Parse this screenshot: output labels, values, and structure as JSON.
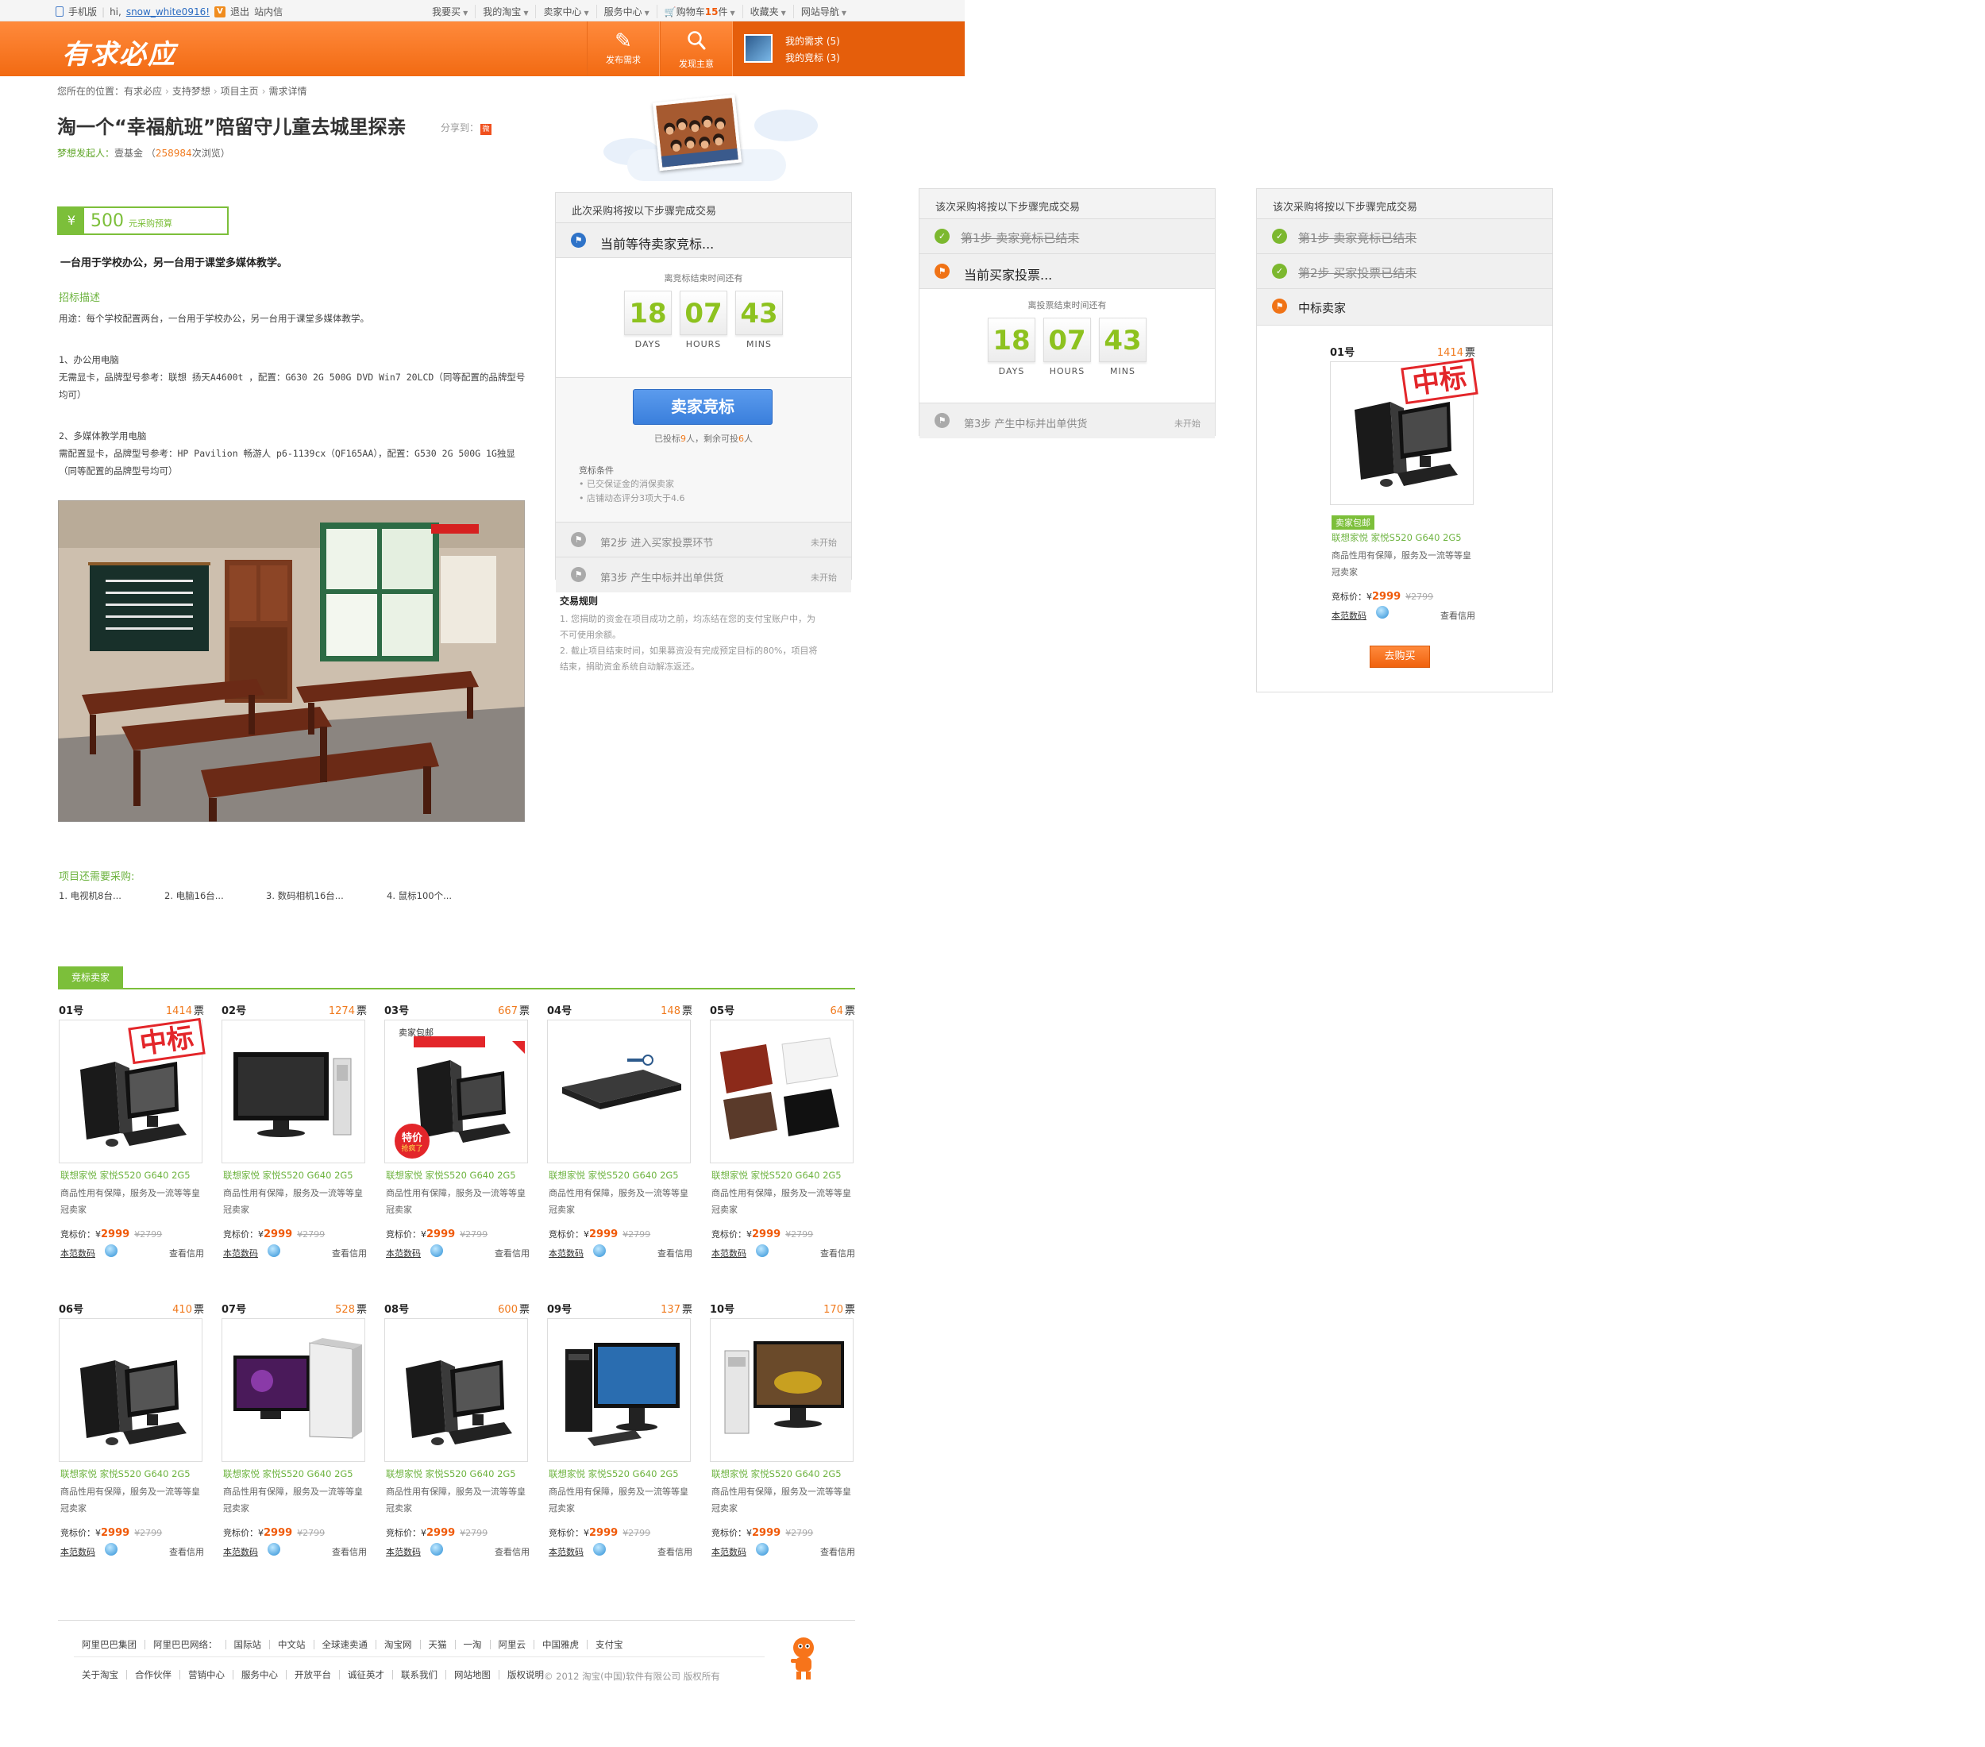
{
  "topbar": {
    "mobile": "手机版",
    "hi": "hi,",
    "username": "snow_white0916!",
    "v_badge": "V",
    "logout": "退出",
    "messages": "站内信",
    "links": [
      {
        "label": "我要买",
        "caret": true
      },
      {
        "label": "我的淘宝",
        "caret": true
      },
      {
        "label": "卖家中心",
        "caret": true
      },
      {
        "label": "服务中心",
        "caret": true
      },
      {
        "label": "购物车",
        "count": "15",
        "unit": "件",
        "caret": true
      },
      {
        "label": "收藏夹",
        "caret": true
      },
      {
        "label": "网站导航",
        "caret": true
      }
    ]
  },
  "header": {
    "logo": "有求必应",
    "btn_post": "发布需求",
    "btn_find": "发现主意",
    "my_requests": "我的需求 (5)",
    "my_bids": "我的竞标 (3)"
  },
  "breadcrumb": {
    "prefix": "您所在的位置：",
    "items": [
      "有求必应",
      "支持梦想",
      "项目主页",
      "需求详情"
    ]
  },
  "page_title": "淘一个“幸福航班”陪留守儿童去城里探亲",
  "share_label": "分享到：",
  "initiator": {
    "label": "梦想发起人：",
    "name": "壹基金",
    "open": "（",
    "views": "258984",
    "views_suffix": "次浏览）"
  },
  "budget": {
    "yen": "¥",
    "amount": "500",
    "label": "元采购预算"
  },
  "summary": "一台用于学校办公，另一台用于课堂多媒体教学。",
  "description": {
    "heading": "招标描述",
    "lines": [
      "用途：每个学校配置两台，一台用于学校办公，另一台用于课堂多媒体教学。",
      "1、办公用电脑",
      "无需显卡，品牌型号参考：联想 扬天A4600t ，配置：G630 2G 500G DVD Win7 20LCD（同等配置的品牌型号",
      "均可）",
      "2、多媒体教学用电脑",
      "需配置显卡，品牌型号参考：HP Pavilion 畅游人 p6-1139cx（QF165AA），配置：G530 2G 500G 1G独显",
      "（同等配置的品牌型号均可）"
    ]
  },
  "more_purchases": {
    "heading": "项目还需要采购:",
    "items": [
      "1. 电视机8台...",
      "2. 电脑16台...",
      "3. 数码相机16台...",
      "4. 鼠标100个..."
    ]
  },
  "panel1": {
    "header": "此次采购将按以下步骤完成交易",
    "current": "当前等待卖家竞标...",
    "countdown_title": "离竞标结束时间还有",
    "days": "18",
    "hours": "07",
    "mins": "43",
    "days_label": "DAYS",
    "hours_label": "HOURS",
    "mins_label": "MINS",
    "button": "卖家竞标",
    "bid_status_prefix": "已投标",
    "bid_count": "9",
    "bid_status_mid": "人，剩余可投",
    "bid_left": "6",
    "bid_status_suffix": "人",
    "conditions_title": "竞标条件",
    "conditions": [
      "• 已交保证金的消保卖家",
      "• 店铺动态评分3项大于4.6"
    ],
    "step2": "第2步   进入买家投票环节",
    "step3": "第3步   产生中标并出单供货",
    "not_started": "未开始",
    "rules_title": "交易规则",
    "rules": [
      "1. 您捐助的资金在项目成功之前，均冻结在您的支付宝账户中，为",
      "不可使用余额。",
      "2. 截止项目结束时间，如果募资没有完成预定目标的80%，项目将",
      "结束，捐助资金系统自动解冻返还。"
    ]
  },
  "panel2": {
    "header": "该次采购将按以下步骤完成交易",
    "step1": "第1步   卖家竞标已结束",
    "current": "当前买家投票...",
    "countdown_title": "离投票结束时间还有",
    "days": "18",
    "hours": "07",
    "mins": "43",
    "days_label": "DAYS",
    "hours_label": "HOURS",
    "mins_label": "MINS",
    "step3": "第3步   产生中标并出单供货",
    "not_started": "未开始"
  },
  "panel3": {
    "header": "该次采购将按以下步骤完成交易",
    "step1": "第1步   卖家竞标已结束",
    "step2": "第2步   买家投票已结束",
    "step3": "中标卖家",
    "winner": {
      "no": "01号",
      "votes": "1414",
      "votes_unit": "票",
      "stamp": "中标",
      "free_tag": "卖家包邮",
      "name": "联想家悦 家悦S520 G640 2G5",
      "desc": "商品性用有保障，服务及一流等等皇冠卖家",
      "price_label": "竞标价：¥",
      "price": "2999",
      "old_price": "¥2799",
      "seller": "本范数码",
      "credit": "查看信用",
      "buy": "去购买"
    }
  },
  "bidders_tab": "竞标卖家",
  "bidders": [
    {
      "no": "01号",
      "votes": "1414",
      "unit": "票",
      "stamp": "中标",
      "img": "tower-crt"
    },
    {
      "no": "02号",
      "votes": "1274",
      "unit": "票",
      "img": "monitor-tower"
    },
    {
      "no": "03号",
      "votes": "667",
      "unit": "票",
      "img": "promo",
      "promo_top": "卖家包邮",
      "promo_sale": "特价",
      "promo_sale2": "抢疯了"
    },
    {
      "no": "04号",
      "votes": "148",
      "unit": "票",
      "img": "laptop-black"
    },
    {
      "no": "05号",
      "votes": "64",
      "unit": "票",
      "img": "laptops-color"
    },
    {
      "no": "06号",
      "votes": "410",
      "unit": "票",
      "img": "tower-crt"
    },
    {
      "no": "07号",
      "votes": "528",
      "unit": "票",
      "img": "wide-monitor"
    },
    {
      "no": "08号",
      "votes": "600",
      "unit": "票",
      "img": "tower-crt"
    },
    {
      "no": "09号",
      "votes": "137",
      "unit": "票",
      "img": "thinkcentre"
    },
    {
      "no": "10号",
      "votes": "170",
      "unit": "票",
      "img": "asus-desktop"
    }
  ],
  "bidder_common": {
    "name": "联想家悦 家悦S520 G640 2G5",
    "desc": "商品性用有保障，服务及一流等等皇冠卖家",
    "price_label": "竞标价：¥",
    "price": "2999",
    "old_price": "¥2799",
    "seller": "本范数码",
    "credit": "查看信用"
  },
  "footer": {
    "row1": [
      "阿里巴巴集团",
      "阿里巴巴网络：",
      "国际站",
      "中文站",
      "全球速卖通",
      "淘宝网",
      "天猫",
      "一淘",
      "阿里云",
      "中国雅虎",
      "支付宝"
    ],
    "row2": [
      "关于淘宝",
      "合作伙伴",
      "营销中心",
      "服务中心",
      "开放平台",
      "诚征英才",
      "联系我们",
      "网站地图",
      "版权说明"
    ],
    "copyright": "© 2012 淘宝(中国)软件有限公司 版权所有"
  },
  "colors": {
    "brand_orange": "#f26a12",
    "accent_green": "#7cbf3a",
    "link_green": "#6db33f",
    "price_orange": "#f05a0a",
    "button_blue": "#3a7fdc"
  }
}
